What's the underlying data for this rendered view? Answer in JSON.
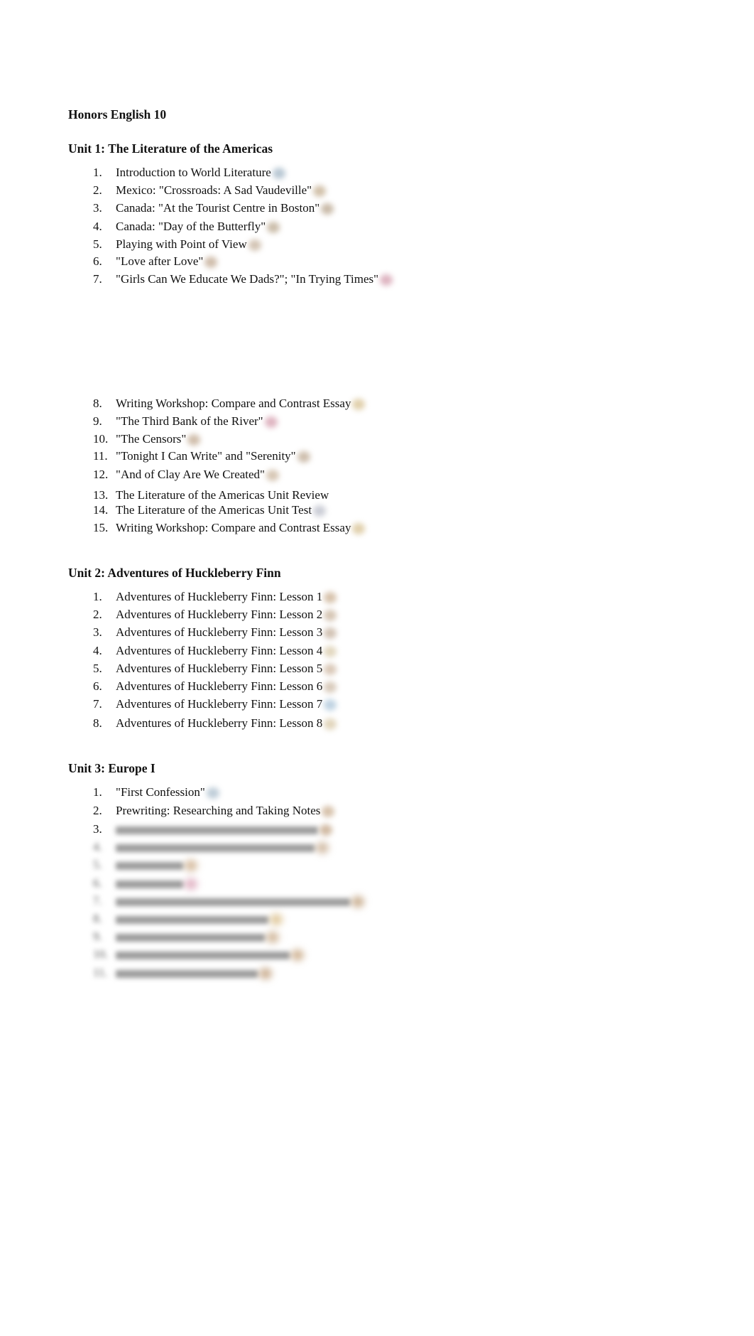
{
  "document": {
    "title": "Honors English 10",
    "units": [
      {
        "heading": "Unit 1: The Literature of the Americas",
        "items": [
          {
            "n": "1.",
            "text": "Introduction to World Literature",
            "icon_color": "#9fb4c4"
          },
          {
            "n": "2.",
            "text": "Mexico: \"Crossroads: A Sad Vaudeville\"",
            "icon_color": "#c2ab8c"
          },
          {
            "n": "3.",
            "text": "Canada: \"At the Tourist Centre in Boston\"",
            "icon_color": "#b7a38b"
          },
          {
            "n": "4.",
            "text": "Canada: \"Day of the Butterfly\"",
            "icon_color": "#b9a68c"
          },
          {
            "n": "5.",
            "text": "Playing with Point of View",
            "icon_color": "#c4b09a"
          },
          {
            "n": "6.",
            "text": "\"Love after Love\"",
            "icon_color": "#bfa68e"
          },
          {
            "n": "7.",
            "text": "\"Girls Can We Educate We Dads?\"; \"In Trying Times\"",
            "icon_color": "#d39aab"
          },
          {
            "n": "8.",
            "text": "Writing Workshop: Compare and Contrast Essay",
            "icon_color": "#d6bf8e"
          },
          {
            "n": "9.",
            "text": "\"The Third Bank of the River\"",
            "icon_color": "#d49aab"
          },
          {
            "n": "10.",
            "text": "\"The Censors\"",
            "icon_color": "#c0a78e"
          },
          {
            "n": "11.",
            "text": "\"Tonight I Can Write\" and \"Serenity\"",
            "icon_color": "#bda891"
          },
          {
            "n": "12.",
            "text": "\"And of Clay Are We Created\"",
            "icon_color": "#c8b299"
          },
          {
            "n": "13.",
            "text": "The Literature of the Americas Unit Review",
            "icon_color": ""
          },
          {
            "n": "14.",
            "text": "The Literature of the Americas Unit Test",
            "icon_color": "#b9bcc8"
          },
          {
            "n": "15.",
            "text": "Writing Workshop: Compare and Contrast Essay",
            "icon_color": "#d6bf8e"
          }
        ]
      },
      {
        "heading": "Unit 2: Adventures of Huckleberry Finn",
        "items": [
          {
            "n": "1.",
            "text": "Adventures of Huckleberry Finn: Lesson 1",
            "icon_color": "#c9ad8e"
          },
          {
            "n": "2.",
            "text": "Adventures of Huckleberry Finn: Lesson 2",
            "icon_color": "#c7b199"
          },
          {
            "n": "3.",
            "text": "Adventures of Huckleberry Finn: Lesson 3",
            "icon_color": "#c2ad99"
          },
          {
            "n": "4.",
            "text": "Adventures of Huckleberry Finn: Lesson 4",
            "icon_color": "#d8c9a8"
          },
          {
            "n": "5.",
            "text": "Adventures of Huckleberry Finn: Lesson 5",
            "icon_color": "#cdb59e"
          },
          {
            "n": "6.",
            "text": "Adventures of Huckleberry Finn: Lesson 6",
            "icon_color": "#cbb8a3"
          },
          {
            "n": "7.",
            "text": "Adventures of Huckleberry Finn: Lesson 7",
            "icon_color": "#a9c3d8"
          },
          {
            "n": "8.",
            "text": "Adventures of Huckleberry Finn: Lesson 8",
            "icon_color": "#d8c7a4"
          }
        ]
      },
      {
        "heading": "Unit 3: Europe I",
        "items": [
          {
            "n": "1.",
            "text": "\"First Confession\"",
            "icon_color": "#a9bccb"
          },
          {
            "n": "2.",
            "text": "Prewriting: Researching and Taking Notes",
            "icon_color": "#c9ad8e"
          },
          {
            "n": "3.",
            "text": "",
            "icon_color": "#c2a384"
          }
        ],
        "blurred_items_count": 8
      }
    ]
  }
}
